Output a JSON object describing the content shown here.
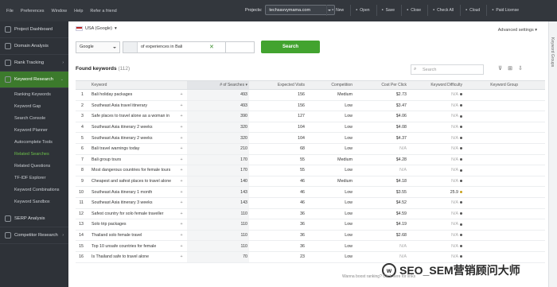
{
  "menubar": {
    "menus": [
      "File",
      "Preferences",
      "Window",
      "Help",
      "Refer a friend"
    ],
    "project_label": "Projects:",
    "project_value": "techsavvymama.com",
    "tools": [
      {
        "icon": "new-icon",
        "label": "New"
      },
      {
        "icon": "open-icon",
        "label": "Open"
      },
      {
        "icon": "save-icon",
        "label": "Save"
      },
      {
        "icon": "close-icon",
        "label": "Close"
      },
      {
        "icon": "check-icon",
        "label": "Check All"
      },
      {
        "icon": "cloud-icon",
        "label": "Cloud"
      },
      {
        "icon": "license-icon",
        "label": "Paid License"
      }
    ]
  },
  "sidebar": {
    "items": [
      {
        "label": "Project Dashboard"
      },
      {
        "label": "Domain Analysis"
      },
      {
        "label": "Rank Tracking"
      },
      {
        "label": "Keyword Research"
      }
    ],
    "subitems": [
      "Ranking Keywords",
      "Keyword Gap",
      "Search Console",
      "Keyword Planner",
      "Autocomplete Tools",
      "Related Searches",
      "Related Questions",
      "TF-IDF Explorer",
      "Keyword Combinations",
      "Keyword Sandbox"
    ],
    "bottom_items": [
      {
        "label": "SERP Analysis"
      },
      {
        "label": "Competitor Research"
      }
    ]
  },
  "main": {
    "location": "USA (Google)",
    "advanced": "Advanced settings",
    "engine": "Google",
    "query": "of experiences in Bali",
    "search_button": "Search",
    "found_title": "Found keywords",
    "found_count": "(112)",
    "search_placeholder": "Search",
    "right_strip": "Keyword Groups"
  },
  "table": {
    "headers": {
      "kw": "Keyword",
      "srch": "# of Searches",
      "vis": "Expected Visits",
      "comp": "Competition",
      "cpc": "Cost Per Click",
      "diff": "Keyword Difficulty",
      "grp": "Keyword Group"
    },
    "rows": [
      {
        "i": "1",
        "kw": "Bali holiday packages",
        "s": "493",
        "v": "156",
        "c": "Medium",
        "cpc": "$2.73",
        "d": "N/A"
      },
      {
        "i": "2",
        "kw": "Southeast Asia travel itinerary",
        "s": "493",
        "v": "156",
        "c": "Low",
        "cpc": "$3.47",
        "d": "N/A"
      },
      {
        "i": "3",
        "kw": "Safe places to travel alone as a woman in",
        "s": "390",
        "v": "127",
        "c": "Low",
        "cpc": "$4.06",
        "d": "N/A"
      },
      {
        "i": "4",
        "kw": "Southeast Asia itinerary 2 weeks",
        "s": "320",
        "v": "104",
        "c": "Low",
        "cpc": "$4.08",
        "d": "N/A"
      },
      {
        "i": "5",
        "kw": "Southeast Asia itinerary 2 weeks",
        "s": "320",
        "v": "104",
        "c": "Low",
        "cpc": "$4.37",
        "d": "N/A"
      },
      {
        "i": "6",
        "kw": "Bali travel warnings today",
        "s": "210",
        "v": "68",
        "c": "Low",
        "cpc": "N/A",
        "d": "N/A"
      },
      {
        "i": "7",
        "kw": "Bali group tours",
        "s": "170",
        "v": "55",
        "c": "Medium",
        "cpc": "$4.28",
        "d": "N/A"
      },
      {
        "i": "8",
        "kw": "Most dangerous countries for female tours",
        "s": "170",
        "v": "55",
        "c": "Low",
        "cpc": "N/A",
        "d": "N/A"
      },
      {
        "i": "9",
        "kw": "Cheapest and safest places to travel alone",
        "s": "140",
        "v": "46",
        "c": "Medium",
        "cpc": "$4.18",
        "d": "N/A"
      },
      {
        "i": "10",
        "kw": "Southeast Asia itinerary 1 month",
        "s": "143",
        "v": "46",
        "c": "Low",
        "cpc": "$3.55",
        "d": "25.9"
      },
      {
        "i": "11",
        "kw": "Southeast Asia itinerary 3 weeks",
        "s": "143",
        "v": "46",
        "c": "Low",
        "cpc": "$4.52",
        "d": "N/A"
      },
      {
        "i": "12",
        "kw": "Safest country for solo female traveller",
        "s": "110",
        "v": "36",
        "c": "Low",
        "cpc": "$4.59",
        "d": "N/A"
      },
      {
        "i": "13",
        "kw": "Solo trip packages",
        "s": "110",
        "v": "36",
        "c": "Low",
        "cpc": "$4.19",
        "d": "N/A"
      },
      {
        "i": "14",
        "kw": "Thailand solo female travel",
        "s": "110",
        "v": "36",
        "c": "Low",
        "cpc": "$2.68",
        "d": "N/A"
      },
      {
        "i": "15",
        "kw": "Top 10 unsafe countries for female",
        "s": "110",
        "v": "36",
        "c": "Low",
        "cpc": "N/A",
        "d": "N/A"
      },
      {
        "i": "16",
        "kw": "Is Thailand safe to travel alone",
        "s": "70",
        "v": "23",
        "c": "Low",
        "cpc": "N/A",
        "d": "N/A"
      }
    ]
  },
  "watermark": {
    "text": "SEO_SEM营销顾问大师",
    "footer": "Wanna boost ranking? Click here for links"
  }
}
